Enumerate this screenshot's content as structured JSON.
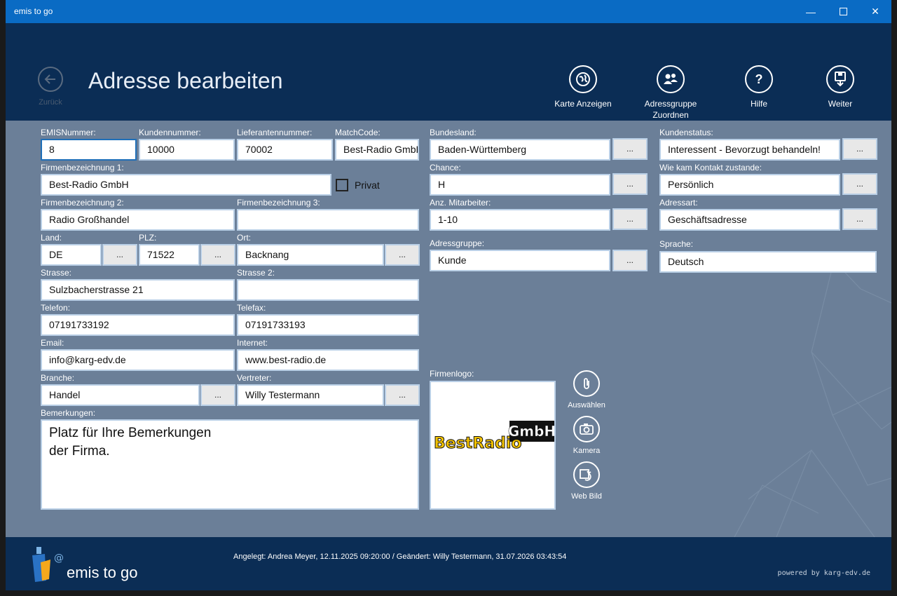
{
  "window": {
    "title": "emis to go",
    "minimize_icon": "minimize-icon",
    "maximize_icon": "maximize-icon",
    "close_icon": "close-icon"
  },
  "header": {
    "back_label": "Zurück",
    "page_title": "Adresse bearbeiten",
    "buttons": [
      {
        "label": "Karte Anzeigen",
        "icon": "globe-icon"
      },
      {
        "label": "Adressgruppe Zuordnen",
        "icon": "people-icon"
      },
      {
        "label": "Hilfe",
        "icon": "help-icon"
      },
      {
        "label": "Weiter",
        "icon": "save-icon"
      }
    ]
  },
  "form": {
    "emisnummer": {
      "label": "EMISNummer:",
      "value": "8"
    },
    "kundennummer": {
      "label": "Kundennummer:",
      "value": "10000"
    },
    "lieferantennummer": {
      "label": "Lieferantennummer:",
      "value": "70002"
    },
    "matchcode": {
      "label": "MatchCode:",
      "value": "Best-Radio GmbH"
    },
    "firma1": {
      "label": "Firmenbezeichnung 1:",
      "value": "Best-Radio GmbH"
    },
    "privat": {
      "label": "Privat",
      "checked": false
    },
    "firma2": {
      "label": "Firmenbezeichnung 2:",
      "value": "Radio Großhandel"
    },
    "firma3": {
      "label": "Firmenbezeichnung 3:",
      "value": ""
    },
    "land": {
      "label": "Land:",
      "value": "DE"
    },
    "plz": {
      "label": "PLZ:",
      "value": "71522"
    },
    "ort": {
      "label": "Ort:",
      "value": "Backnang"
    },
    "strasse": {
      "label": "Strasse:",
      "value": "Sulzbacherstrasse 21"
    },
    "strasse2": {
      "label": "Strasse 2:",
      "value": ""
    },
    "telefon": {
      "label": "Telefon:",
      "value": "07191733192"
    },
    "telefax": {
      "label": "Telefax:",
      "value": "07191733193"
    },
    "email": {
      "label": "Email:",
      "value": "info@karg-edv.de"
    },
    "internet": {
      "label": "Internet:",
      "value": "www.best-radio.de"
    },
    "branche": {
      "label": "Branche:",
      "value": "Handel"
    },
    "vertreter": {
      "label": "Vertreter:",
      "value": "Willy Testermann"
    },
    "bemerkungen": {
      "label": "Bemerkungen:",
      "value": "Platz für Ihre Bemerkungen\nder Firma."
    },
    "bundesland": {
      "label": "Bundesland:",
      "value": "Baden-Württemberg"
    },
    "chance": {
      "label": "Chance:",
      "value": "H"
    },
    "mitarbeiter": {
      "label": "Anz. Mitarbeiter:",
      "value": "1-10"
    },
    "adressgruppe": {
      "label": "Adressgruppe:",
      "value": "Kunde"
    },
    "kundenstatus": {
      "label": "Kundenstatus:",
      "value": "Interessent - Bevorzugt behandeln!"
    },
    "kontakt": {
      "label": "Wie kam Kontakt zustande:",
      "value": "Persönlich"
    },
    "adressart": {
      "label": "Adressart:",
      "value": "Geschäftsadresse"
    },
    "sprache": {
      "label": "Sprache:",
      "value": "Deutsch"
    },
    "ellipsis": "...",
    "firmenlogo": {
      "label": "Firmenlogo:",
      "logo_text": "BestRadio",
      "logo_badge": "GmbH"
    },
    "logo_buttons": [
      {
        "label": "Auswählen",
        "icon": "paperclip-icon"
      },
      {
        "label": "Kamera",
        "icon": "camera-icon"
      },
      {
        "label": "Web Bild",
        "icon": "web-image-icon"
      }
    ]
  },
  "footer": {
    "meta": "Angelegt: Andrea Meyer, 12.11.2025 09:20:00  /  Geändert: Willy Testermann, 31.07.2026 03:43:54",
    "brand": "emis to go",
    "powered": "powered by karg-edv.de"
  },
  "colors": {
    "titlebar": "#0a6bc4",
    "header": "#0b2d55",
    "form_bg": "#6b7f98",
    "logo_yellow": "#f5c400"
  }
}
